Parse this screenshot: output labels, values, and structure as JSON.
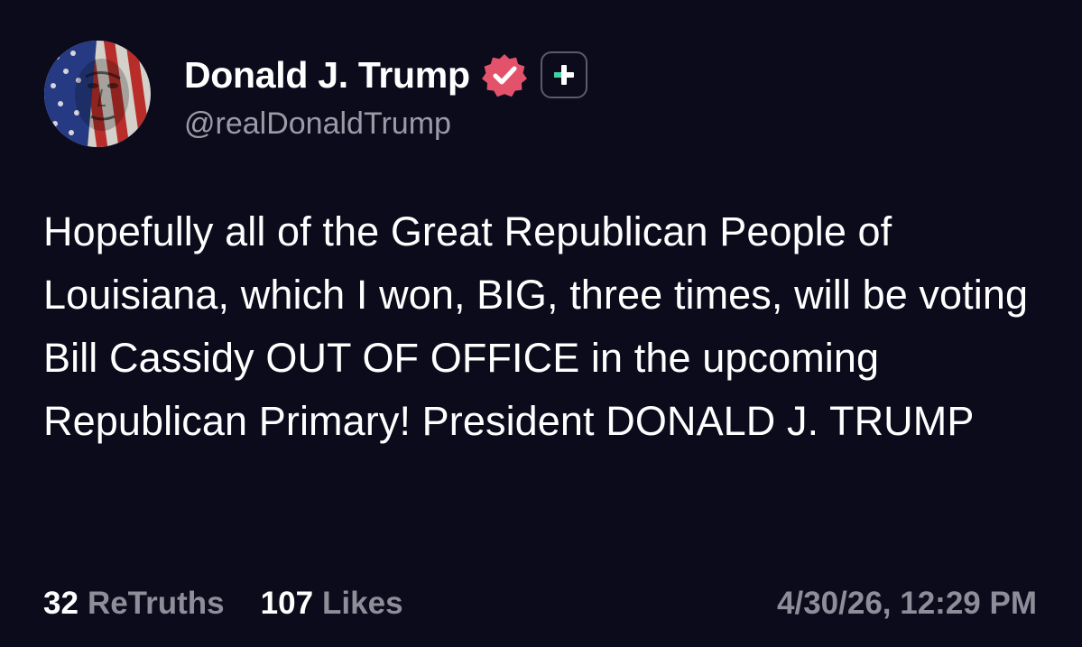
{
  "author": {
    "display_name": "Donald J. Trump",
    "handle": "@realDonaldTrump",
    "avatar_icon": "flag-portrait-avatar",
    "verified_icon": "verified-badge-icon",
    "plus_icon": "truth-plus-icon"
  },
  "post": {
    "text": "Hopefully all of the Great Republican People of Louisiana, which I won, BIG, three times, will be voting Bill Cassidy OUT OF OFFICE in the upcoming Republican Primary! President DONALD J. TRUMP"
  },
  "stats": {
    "retruths_count": "32",
    "retruths_label": "ReTruths",
    "likes_count": "107",
    "likes_label": "Likes"
  },
  "timestamp": "4/30/26, 12:29 PM",
  "colors": {
    "background": "#0c0b1c",
    "verified_badge": "#e3526b",
    "plus_badge_accent": "#3fd1a6",
    "muted_text": "#8e8d99"
  }
}
